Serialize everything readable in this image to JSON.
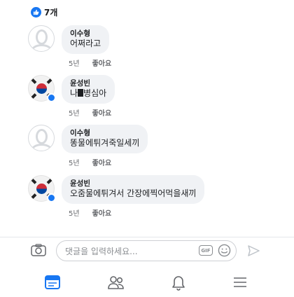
{
  "reactions": {
    "count_label": "7개",
    "icon": "like-icon",
    "color": "#1877f2"
  },
  "comments": [
    {
      "author": "이수형",
      "text": "어쩌라고",
      "time": "5년",
      "like_label": "좋아요",
      "avatar": "default-profile-icon"
    },
    {
      "author": "윤성빈",
      "text_after_redaction": "병심아",
      "text_before_redaction": "나",
      "time": "5년",
      "like_label": "좋아요",
      "avatar": "korean-flag-icon"
    },
    {
      "author": "이수형",
      "text": "똥물에튀겨죽일세끼",
      "time": "5년",
      "like_label": "좋아요",
      "avatar": "default-profile-icon"
    },
    {
      "author": "윤성빈",
      "text": "오줌물에튀겨서 간장에찍어먹을새끼",
      "time": "5년",
      "like_label": "좋아요",
      "avatar": "korean-flag-icon"
    }
  ],
  "composer": {
    "placeholder": "댓글을 입력하세요...",
    "gif_label": "GIF",
    "camera_icon": "camera-icon",
    "emoji_icon": "emoji-icon",
    "send_icon": "send-icon"
  },
  "bottom_nav": [
    "news-feed-icon",
    "friends-icon",
    "notifications-icon",
    "menu-icon"
  ],
  "colors": {
    "accent": "#1877f2",
    "bubble": "#f0f2f5",
    "muted": "#65676b"
  }
}
